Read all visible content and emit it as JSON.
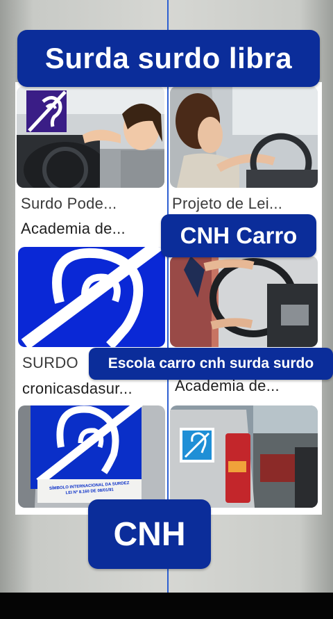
{
  "overlays": {
    "title": "Surda surdo libra",
    "cnh_carro": "CNH Carro",
    "escola": "Escola carro cnh  surda surdo",
    "cnh": "CNH"
  },
  "results": [
    {
      "title": "Surdo Pode...",
      "source": "Academia de..."
    },
    {
      "title": "Projeto de Lei...",
      "source": ""
    },
    {
      "title": "SURDO",
      "source": "cronicasdasur..."
    },
    {
      "title": "",
      "source": "Academia de..."
    }
  ],
  "sign_text": {
    "line1": "SÍMBOLO INTERNACIONAL DA SURDEZ",
    "line2": "LEI Nº 8.160 DE 08/01/91"
  },
  "colors": {
    "banner_blue": "#0b2d9a",
    "deaf_symbol_blue": "#0a28d6",
    "center_line": "#2d5fd1"
  },
  "icons": [
    "deaf-symbol-icon"
  ]
}
